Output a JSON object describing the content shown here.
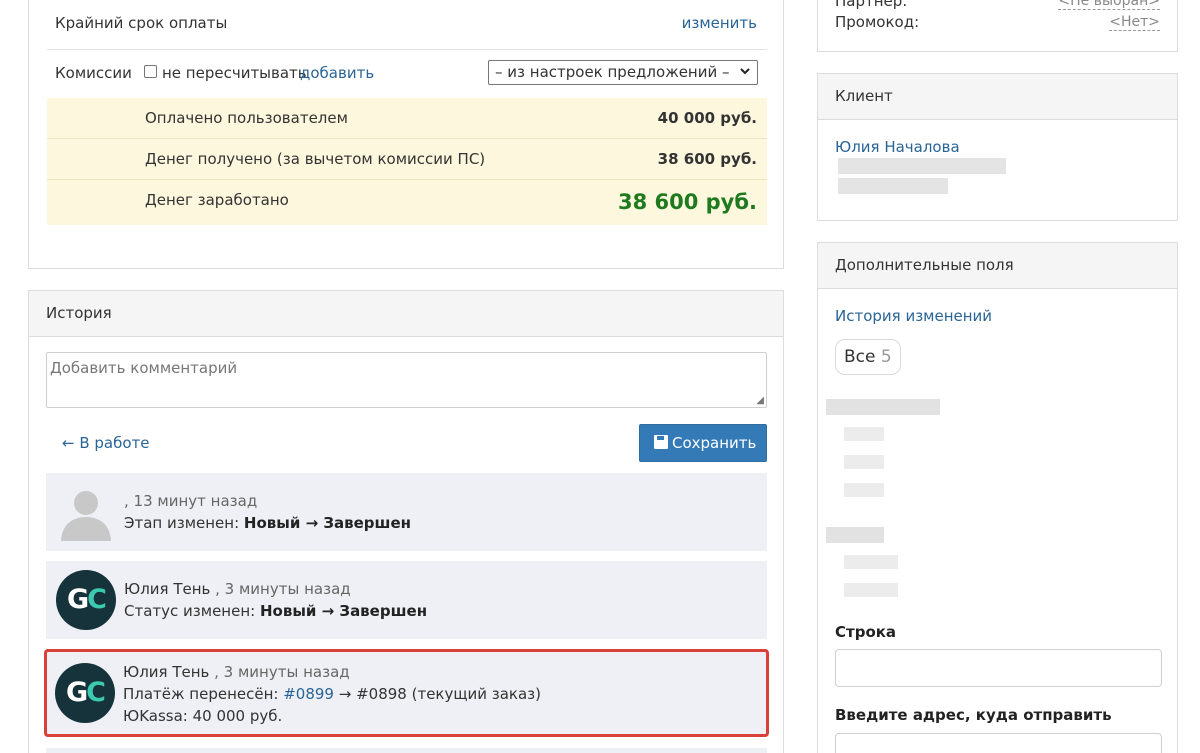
{
  "payment": {
    "deadline_label": "Крайний срок оплаты",
    "deadline_change": "изменить",
    "commission_label": "Комиссии",
    "no_recalc_label": "не пересчитывать",
    "add_link": "добавить",
    "commission_select_value": "– из настроек предложений –",
    "summary": [
      {
        "label": "Оплачено пользователем",
        "value": "40 000 руб."
      },
      {
        "label": "Денег получено (за вычетом комиссии ПС)",
        "value": "38 600 руб."
      },
      {
        "label": "Денег заработано",
        "value": "38 600 руб."
      }
    ]
  },
  "history": {
    "title": "История",
    "comment_placeholder": "Добавить комментарий",
    "back_link": "← В работе",
    "save_label": "Сохранить",
    "events": [
      {
        "author": "",
        "time": ", 13 минут назад",
        "line1_prefix": "Этап изменен: ",
        "line1_change": "Новый → Завершен"
      },
      {
        "author": "Юлия Тень",
        "time": " , 3 минуты назад",
        "line1_prefix": "Статус изменен: ",
        "line1_change": "Новый → Завершен"
      },
      {
        "author": "Юлия Тень",
        "time": " , 3 минуты назад",
        "line1_prefix": "Платёж перенесён: ",
        "line1_link": "#0899",
        "line1_suffix": " → #0898 (текущий заказ)",
        "line2": "ЮKassa: 40 000 руб."
      }
    ],
    "avatar_initials": {
      "g": "G",
      "c": "C"
    }
  },
  "sidebar": {
    "partner_label": "Партнер:",
    "partner_value": "<Не выбран>",
    "promo_label": "Промокод:",
    "promo_value": "<Нет>",
    "client_title": "Клиент",
    "client_name": "Юлия Началова",
    "extra_title": "Дополнительные поля",
    "history_link": "История изменений",
    "filter_all_label": "Все",
    "filter_all_count": "5",
    "field_string_label": "Строка",
    "field_address_label": "Введите адрес, куда отправить"
  },
  "colors": {
    "accent": "#337ab7",
    "link": "#2a6496",
    "earned": "#1f7a1f",
    "highlight_border": "#d9403a",
    "summary_bg": "#fcf7dd"
  }
}
